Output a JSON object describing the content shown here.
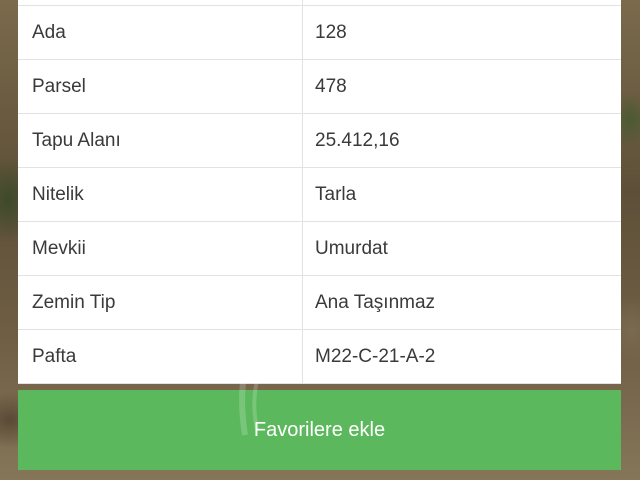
{
  "property_info": {
    "rows": [
      {
        "label": "Ada",
        "value": "128"
      },
      {
        "label": "Parsel",
        "value": "478"
      },
      {
        "label": "Tapu Alanı",
        "value": "25.412,16"
      },
      {
        "label": "Nitelik",
        "value": "Tarla"
      },
      {
        "label": "Mevkii",
        "value": "Umurdat"
      },
      {
        "label": "Zemin Tip",
        "value": "Ana Taşınmaz"
      },
      {
        "label": "Pafta",
        "value": "M22-C-21-A-2"
      }
    ]
  },
  "actions": {
    "favorite_label": "Favorilere ekle"
  },
  "colors": {
    "button_green": "#5cb85c",
    "table_background": "#ffffff",
    "divider": "#e2e2e2",
    "text": "#3a3a3a"
  }
}
